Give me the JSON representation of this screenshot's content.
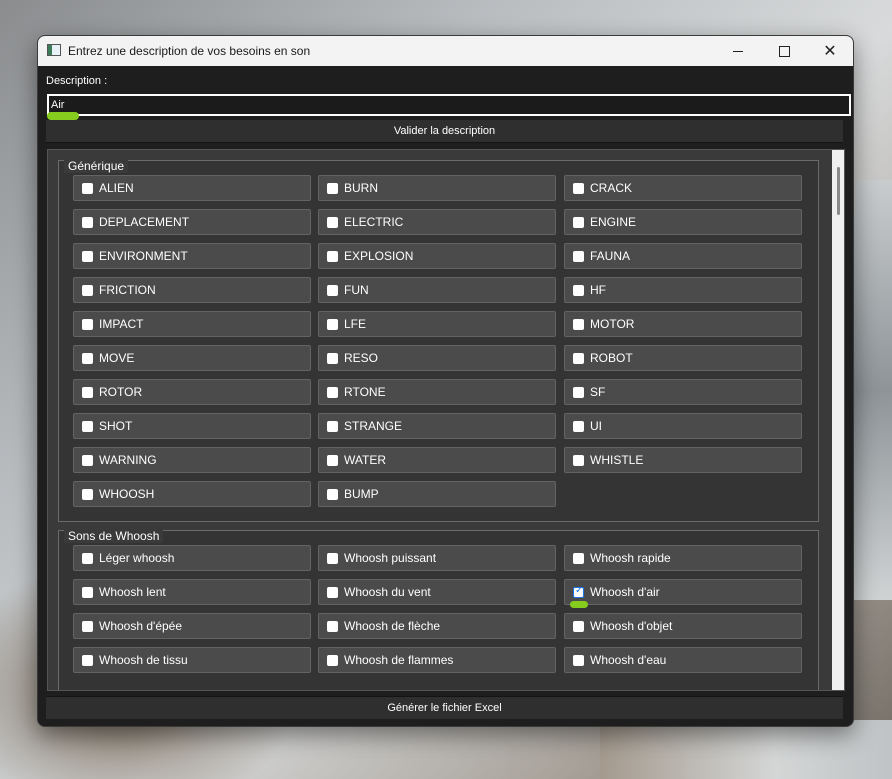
{
  "window": {
    "title": "Entrez une description de vos besoins en son"
  },
  "description": {
    "label": "Description :",
    "value": "Air"
  },
  "buttons": {
    "validate": "Valider la description",
    "generate": "Générer le fichier Excel"
  },
  "groups": {
    "generic": {
      "title": "Générique",
      "items": [
        {
          "label": "ALIEN",
          "checked": false
        },
        {
          "label": "BURN",
          "checked": false
        },
        {
          "label": "CRACK",
          "checked": false
        },
        {
          "label": "DEPLACEMENT",
          "checked": false
        },
        {
          "label": "ELECTRIC",
          "checked": false
        },
        {
          "label": "ENGINE",
          "checked": false
        },
        {
          "label": "ENVIRONMENT",
          "checked": false
        },
        {
          "label": "EXPLOSION",
          "checked": false
        },
        {
          "label": "FAUNA",
          "checked": false
        },
        {
          "label": "FRICTION",
          "checked": false
        },
        {
          "label": "FUN",
          "checked": false
        },
        {
          "label": "HF",
          "checked": false
        },
        {
          "label": "IMPACT",
          "checked": false
        },
        {
          "label": "LFE",
          "checked": false
        },
        {
          "label": "MOTOR",
          "checked": false
        },
        {
          "label": "MOVE",
          "checked": false
        },
        {
          "label": "RESO",
          "checked": false
        },
        {
          "label": "ROBOT",
          "checked": false
        },
        {
          "label": "ROTOR",
          "checked": false
        },
        {
          "label": "RTONE",
          "checked": false
        },
        {
          "label": "SF",
          "checked": false
        },
        {
          "label": "SHOT",
          "checked": false
        },
        {
          "label": "STRANGE",
          "checked": false
        },
        {
          "label": "UI",
          "checked": false
        },
        {
          "label": "WARNING",
          "checked": false
        },
        {
          "label": "WATER",
          "checked": false
        },
        {
          "label": "WHISTLE",
          "checked": false
        },
        {
          "label": "WHOOSH",
          "checked": false
        },
        {
          "label": "BUMP",
          "checked": false
        }
      ]
    },
    "whoosh": {
      "title": "Sons de Whoosh",
      "items": [
        {
          "label": "Léger whoosh",
          "checked": false
        },
        {
          "label": "Whoosh puissant",
          "checked": false
        },
        {
          "label": "Whoosh rapide",
          "checked": false
        },
        {
          "label": "Whoosh lent",
          "checked": false
        },
        {
          "label": "Whoosh du vent",
          "checked": false
        },
        {
          "label": "Whoosh d'air",
          "checked": true
        },
        {
          "label": "Whoosh d'épée",
          "checked": false
        },
        {
          "label": "Whoosh de flèche",
          "checked": false
        },
        {
          "label": "Whoosh d'objet",
          "checked": false
        },
        {
          "label": "Whoosh de tissu",
          "checked": false
        },
        {
          "label": "Whoosh de flammes",
          "checked": false
        },
        {
          "label": "Whoosh d'eau",
          "checked": false
        }
      ]
    }
  },
  "colors": {
    "accent": "#86cc1f",
    "check": "#1a73e8"
  }
}
